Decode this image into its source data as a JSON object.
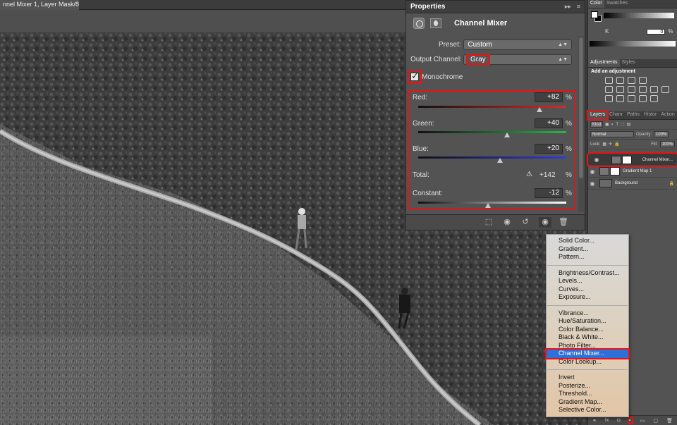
{
  "document": {
    "tab_title": "nnel Mixer 1, Layer Mask/8) *",
    "close_glyph": "×"
  },
  "properties": {
    "header": "Properties",
    "title": "Channel Mixer",
    "preset_label": "Preset:",
    "preset_value": "Custom",
    "output_label": "Output Channel:",
    "output_value": "Gray",
    "monochrome_label": "Monochrome",
    "monochrome_checked": true,
    "sliders": [
      {
        "name": "red",
        "label": "Red:",
        "value": "+82",
        "pct": "%",
        "position": 0.82,
        "color": "#d52b2b"
      },
      {
        "name": "green",
        "label": "Green:",
        "value": "+40",
        "pct": "%",
        "position": 0.6,
        "color": "#27b844"
      },
      {
        "name": "blue",
        "label": "Blue:",
        "value": "+20",
        "pct": "%",
        "position": 0.55,
        "color": "#2f3dd6"
      }
    ],
    "total_label": "Total:",
    "total_value": "+142",
    "total_pct": "%",
    "constant": {
      "label": "Constant:",
      "value": "-12",
      "pct": "%",
      "position": 0.47
    },
    "footer_icons": [
      "clip-to-layer-icon",
      "view-previous-icon",
      "reset-icon",
      "visibility-icon",
      "delete-icon"
    ]
  },
  "color_panel": {
    "tabs": [
      "Color",
      "Swatches"
    ],
    "k_label": "K",
    "k_value": "0",
    "k_pct": "%"
  },
  "adjustments_panel": {
    "tabs": [
      "Adjustments",
      "Styles"
    ],
    "title": "Add an adjustment"
  },
  "layers_panel": {
    "tabs": [
      "Layers",
      "Chanr",
      "Paths",
      "Histor",
      "Action"
    ],
    "kind_label": "Kind",
    "blend_mode": "Normal",
    "opacity_label": "Opacity:",
    "opacity_value": "100%",
    "lock_label": "Lock:",
    "fill_label": "Fill:",
    "fill_value": "100%",
    "layers": [
      {
        "name": "Channel Mixer...",
        "selected": true
      },
      {
        "name": "Gradient Map 1",
        "selected": false
      },
      {
        "name": "Background",
        "selected": false
      }
    ]
  },
  "adjustment_menu": {
    "groups": [
      [
        "Solid Color...",
        "Gradient...",
        "Pattern..."
      ],
      [
        "Brightness/Contrast...",
        "Levels...",
        "Curves...",
        "Exposure..."
      ],
      [
        "Vibrance...",
        "Hue/Saturation...",
        "Color Balance...",
        "Black & White...",
        "Photo Filter...",
        "Channel Mixer...",
        "Color Lookup..."
      ],
      [
        "Invert",
        "Posterize...",
        "Threshold...",
        "Gradient Map...",
        "Selective Color..."
      ]
    ],
    "highlighted": "Channel Mixer..."
  }
}
